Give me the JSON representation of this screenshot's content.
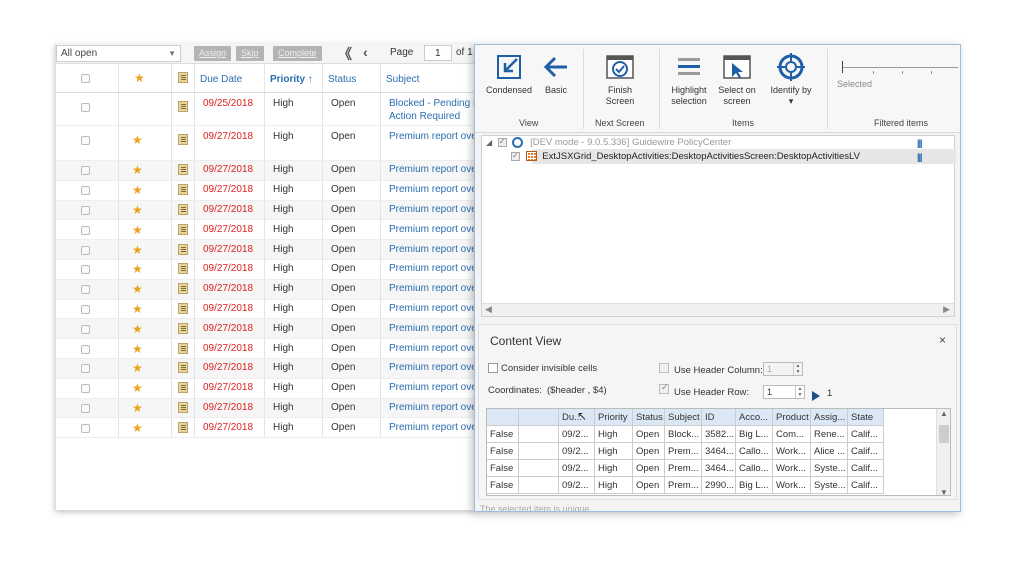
{
  "activities": {
    "filter": {
      "value": "All open"
    },
    "toolbar": {
      "assign": "Assign",
      "skip": "Skip",
      "complete": "Complete",
      "first": "《",
      "prev": "‹",
      "page_label": "Page",
      "page_value": "1",
      "of_label": "of 1"
    },
    "headers": {
      "due_date": "Due Date",
      "priority": "Priority ↑",
      "status": "Status",
      "subject": "Subject"
    },
    "rows": [
      {
        "due": "09/25/2018",
        "priority": "High",
        "status": "Open",
        "subject": "Blocked - Pending R",
        "subject2": "Action Required",
        "star": ""
      },
      {
        "due": "09/27/2018",
        "priority": "High",
        "status": "Open",
        "subject": "Premium report ove",
        "star": "★"
      },
      {
        "due": "09/27/2018",
        "priority": "High",
        "status": "Open",
        "subject": "Premium report ove",
        "star": "★"
      },
      {
        "due": "09/27/2018",
        "priority": "High",
        "status": "Open",
        "subject": "Premium report ove",
        "star": "★"
      },
      {
        "due": "09/27/2018",
        "priority": "High",
        "status": "Open",
        "subject": "Premium report ove",
        "star": "★"
      },
      {
        "due": "09/27/2018",
        "priority": "High",
        "status": "Open",
        "subject": "Premium report ove",
        "star": "★"
      },
      {
        "due": "09/27/2018",
        "priority": "High",
        "status": "Open",
        "subject": "Premium report ove",
        "star": "★"
      },
      {
        "due": "09/27/2018",
        "priority": "High",
        "status": "Open",
        "subject": "Premium report ove",
        "star": "★"
      },
      {
        "due": "09/27/2018",
        "priority": "High",
        "status": "Open",
        "subject": "Premium report ove",
        "star": "★"
      },
      {
        "due": "09/27/2018",
        "priority": "High",
        "status": "Open",
        "subject": "Premium report ove",
        "star": "★"
      },
      {
        "due": "09/27/2018",
        "priority": "High",
        "status": "Open",
        "subject": "Premium report ove",
        "star": "★"
      },
      {
        "due": "09/27/2018",
        "priority": "High",
        "status": "Open",
        "subject": "Premium report ove",
        "star": "★"
      },
      {
        "due": "09/27/2018",
        "priority": "High",
        "status": "Open",
        "subject": "Premium report ove",
        "star": "★"
      },
      {
        "due": "09/27/2018",
        "priority": "High",
        "status": "Open",
        "subject": "Premium report ove",
        "star": "★"
      },
      {
        "due": "09/27/2018",
        "priority": "High",
        "status": "Open",
        "subject": "Premium report ove",
        "star": "★"
      },
      {
        "due": "09/27/2018",
        "priority": "High",
        "status": "Open",
        "subject": "Premium report ove",
        "star": "★"
      }
    ]
  },
  "ribbon": {
    "condensed": "Condensed",
    "basic": "Basic",
    "finish_screen_1": "Finish",
    "finish_screen_2": "Screen",
    "highlight_1": "Highlight",
    "highlight_2": "selection",
    "select_1": "Select on",
    "select_2": "screen",
    "identify": "Identify by",
    "identify_arrow": "▾",
    "slider_label": "Selected",
    "group_view": "View",
    "group_next": "Next Screen",
    "group_items": "Items",
    "group_filtered": "Filtered items"
  },
  "tree": {
    "root": "[DEV mode - 9.0.5.336] Guidewire PolicyCenter",
    "child": "ExtJSXGrid_DesktopActivities:DesktopActivitiesScreen:DesktopActivitiesLV",
    "filter_icon": "|||"
  },
  "content_view": {
    "title": "Content View",
    "close": "×",
    "consider_invisible": "Consider invisible cells",
    "use_header_column": "Use Header Column:",
    "header_column_value": "1",
    "coordinates_label": "Coordinates:",
    "coordinates_value": "($header , $4)",
    "use_header_row": "Use Header Row:",
    "header_row_value": "1",
    "header_row_extra": "1",
    "spin_up": "▲",
    "spin_down": "▼",
    "scroll_up": "▲",
    "scroll_down": "▼",
    "headers": [
      "",
      "",
      "Du...",
      "Priority",
      "Status",
      "Subject",
      "ID",
      "Acco...",
      "Product",
      "Assig...",
      "State"
    ],
    "rows": [
      [
        "False",
        "",
        "09/2...",
        "High",
        "Open",
        "Block...",
        "3582...",
        "Big L...",
        "Com...",
        "Rene...",
        "Calif..."
      ],
      [
        "False",
        "",
        "09/2...",
        "High",
        "Open",
        "Prem...",
        "3464...",
        "Callo...",
        "Work...",
        "Alice ...",
        "Calif..."
      ],
      [
        "False",
        "",
        "09/2...",
        "High",
        "Open",
        "Prem...",
        "3464...",
        "Callo...",
        "Work...",
        "Syste...",
        "Calif..."
      ],
      [
        "False",
        "",
        "09/2...",
        "High",
        "Open",
        "Prem...",
        "2990...",
        "Big L...",
        "Work...",
        "Syste...",
        "Calif..."
      ]
    ]
  },
  "status_text": "The selected item is unique",
  "colors": {
    "accent": "#2a6db0",
    "date_red": "#e02020",
    "star": "#e9a21c",
    "header_blue": "#dce7f6"
  }
}
